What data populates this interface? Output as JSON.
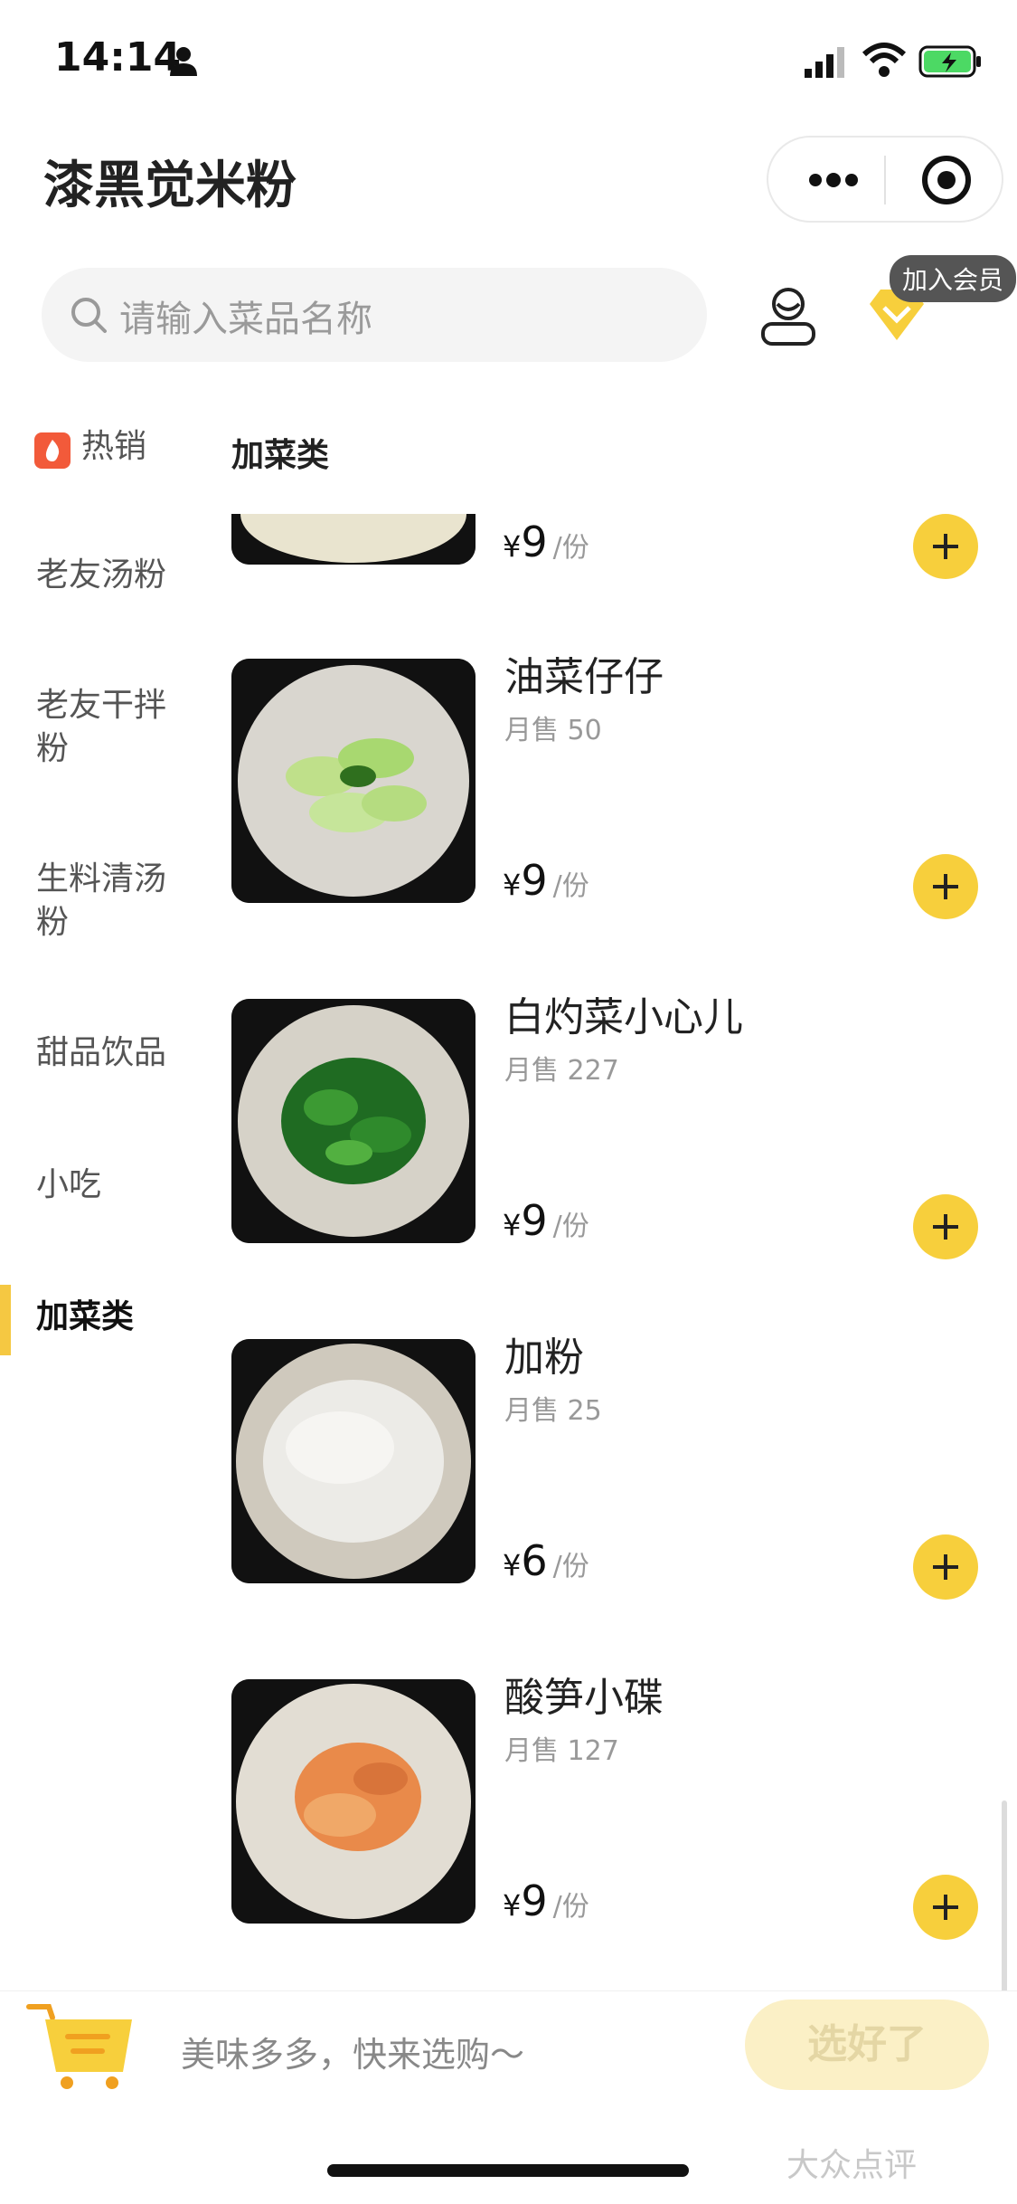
{
  "status_bar": {
    "time": "14:14"
  },
  "header": {
    "title": "漆黑觉米粉"
  },
  "search": {
    "placeholder": "请输入菜品名称"
  },
  "member": {
    "tag": "加入会员"
  },
  "sidebar": {
    "items": [
      {
        "label": "热销"
      },
      {
        "label": "老友汤粉"
      },
      {
        "label": "老友干拌粉"
      },
      {
        "label": "生料清汤粉"
      },
      {
        "label": "甜品饮品"
      },
      {
        "label": "小吃"
      },
      {
        "label": "加菜类"
      }
    ],
    "active": "加菜类"
  },
  "category": {
    "title": "加菜类"
  },
  "dishes": [
    {
      "name": "",
      "sales": "",
      "price": "9",
      "unit": "/份",
      "yen": "¥"
    },
    {
      "name": "油菜仔仔",
      "sales": "月售 50",
      "price": "9",
      "unit": "/份",
      "yen": "¥"
    },
    {
      "name": "白灼菜小心儿",
      "sales": "月售 227",
      "price": "9",
      "unit": "/份",
      "yen": "¥"
    },
    {
      "name": "加粉",
      "sales": "月售 25",
      "price": "6",
      "unit": "/份",
      "yen": "¥"
    },
    {
      "name": "酸笋小碟",
      "sales": "月售 127",
      "price": "9",
      "unit": "/份",
      "yen": "¥"
    }
  ],
  "bottom": {
    "hint": "美味多多，快来选购～",
    "confirm": "选好了"
  },
  "watermark": "大众点评",
  "colors": {
    "accent": "#f7cf3c",
    "hot": "#f25a3a"
  }
}
